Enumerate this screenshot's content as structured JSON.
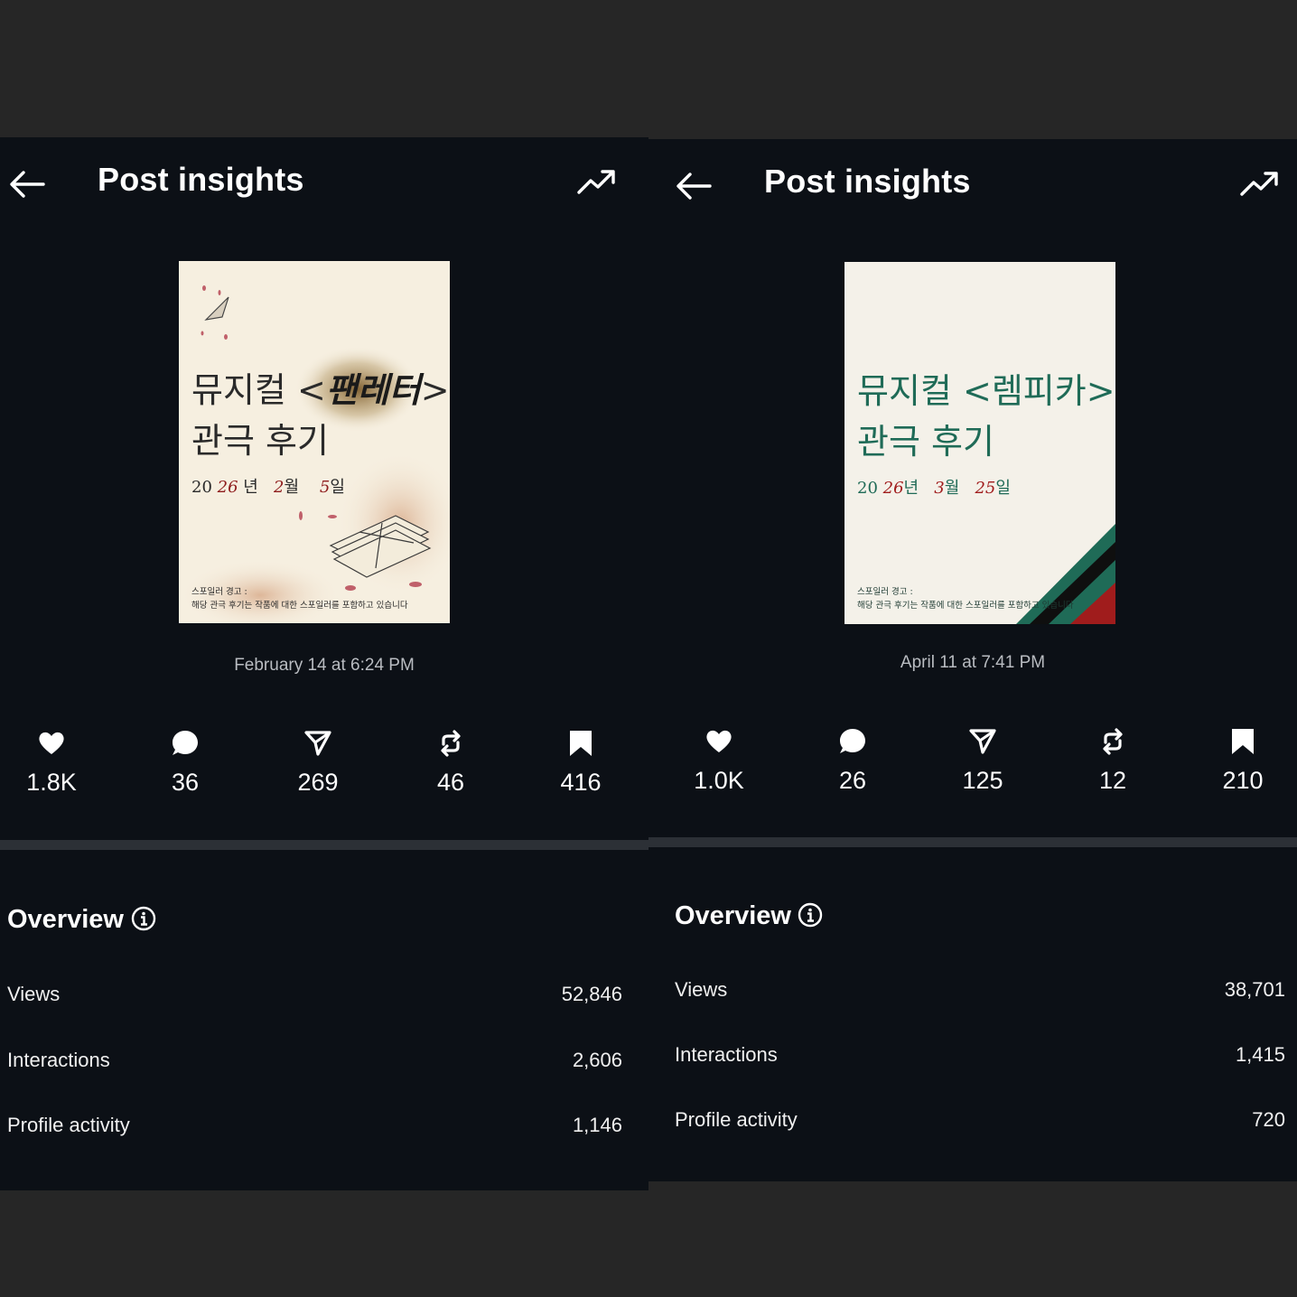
{
  "panels": [
    {
      "header": {
        "title": "Post insights"
      },
      "poster": {
        "title_line1": "뮤지컬 <",
        "title_show": "팬레터",
        "title_end": ">",
        "title_line2": "관극 후기",
        "date_prefix": "20",
        "date_year": "26",
        "date_year_unit": "년",
        "date_month": "2",
        "date_month_unit": "월",
        "date_day": "5",
        "date_day_unit": "일",
        "warning_line1": "스포일러 경고 :",
        "warning_line2": "해당 관극 후기는 작품에 대한 스포일러를 포함하고 있습니다"
      },
      "posted_at": "February 14 at 6:24 PM",
      "stats": {
        "likes": "1.8K",
        "comments": "36",
        "shares": "269",
        "reposts": "46",
        "saves": "416"
      },
      "overview": {
        "title": "Overview",
        "rows": [
          {
            "label": "Views",
            "value": "52,846"
          },
          {
            "label": "Interactions",
            "value": "2,606"
          },
          {
            "label": "Profile activity",
            "value": "1,146"
          }
        ]
      }
    },
    {
      "header": {
        "title": "Post insights"
      },
      "poster": {
        "title_line1": "뮤지컬 <",
        "title_show": "렘피카",
        "title_end": ">",
        "title_line2": "관극 후기",
        "date_prefix": "20",
        "date_year": "26",
        "date_year_unit": "년",
        "date_month": "3",
        "date_month_unit": "월",
        "date_day": "25",
        "date_day_unit": "일",
        "warning_line1": "스포일러 경고 :",
        "warning_line2": "해당 관극 후기는 작품에 대한 스포일러를 포함하고 있습니다"
      },
      "posted_at": "April 11 at 7:41 PM",
      "stats": {
        "likes": "1.0K",
        "comments": "26",
        "shares": "125",
        "reposts": "12",
        "saves": "210"
      },
      "overview": {
        "title": "Overview",
        "rows": [
          {
            "label": "Views",
            "value": "38,701"
          },
          {
            "label": "Interactions",
            "value": "1,415"
          },
          {
            "label": "Profile activity",
            "value": "720"
          }
        ]
      }
    }
  ],
  "icons": {
    "back": "arrow-left-icon",
    "trend": "trending-up-icon",
    "like": "heart-icon",
    "comment": "comment-bubble-icon",
    "share": "send-icon",
    "repost": "repost-icon",
    "save": "bookmark-icon",
    "info": "info-icon"
  },
  "colors": {
    "panel_bg": "#0c1016",
    "outer_bg": "#262626",
    "divider": "#2c3036",
    "poster1_bg": "#f6efe0",
    "poster1_accent": "#8e1b1b",
    "poster2_bg": "#f4f1e9",
    "poster2_text": "#1f6b57",
    "poster2_accent": "#a01c1c"
  }
}
